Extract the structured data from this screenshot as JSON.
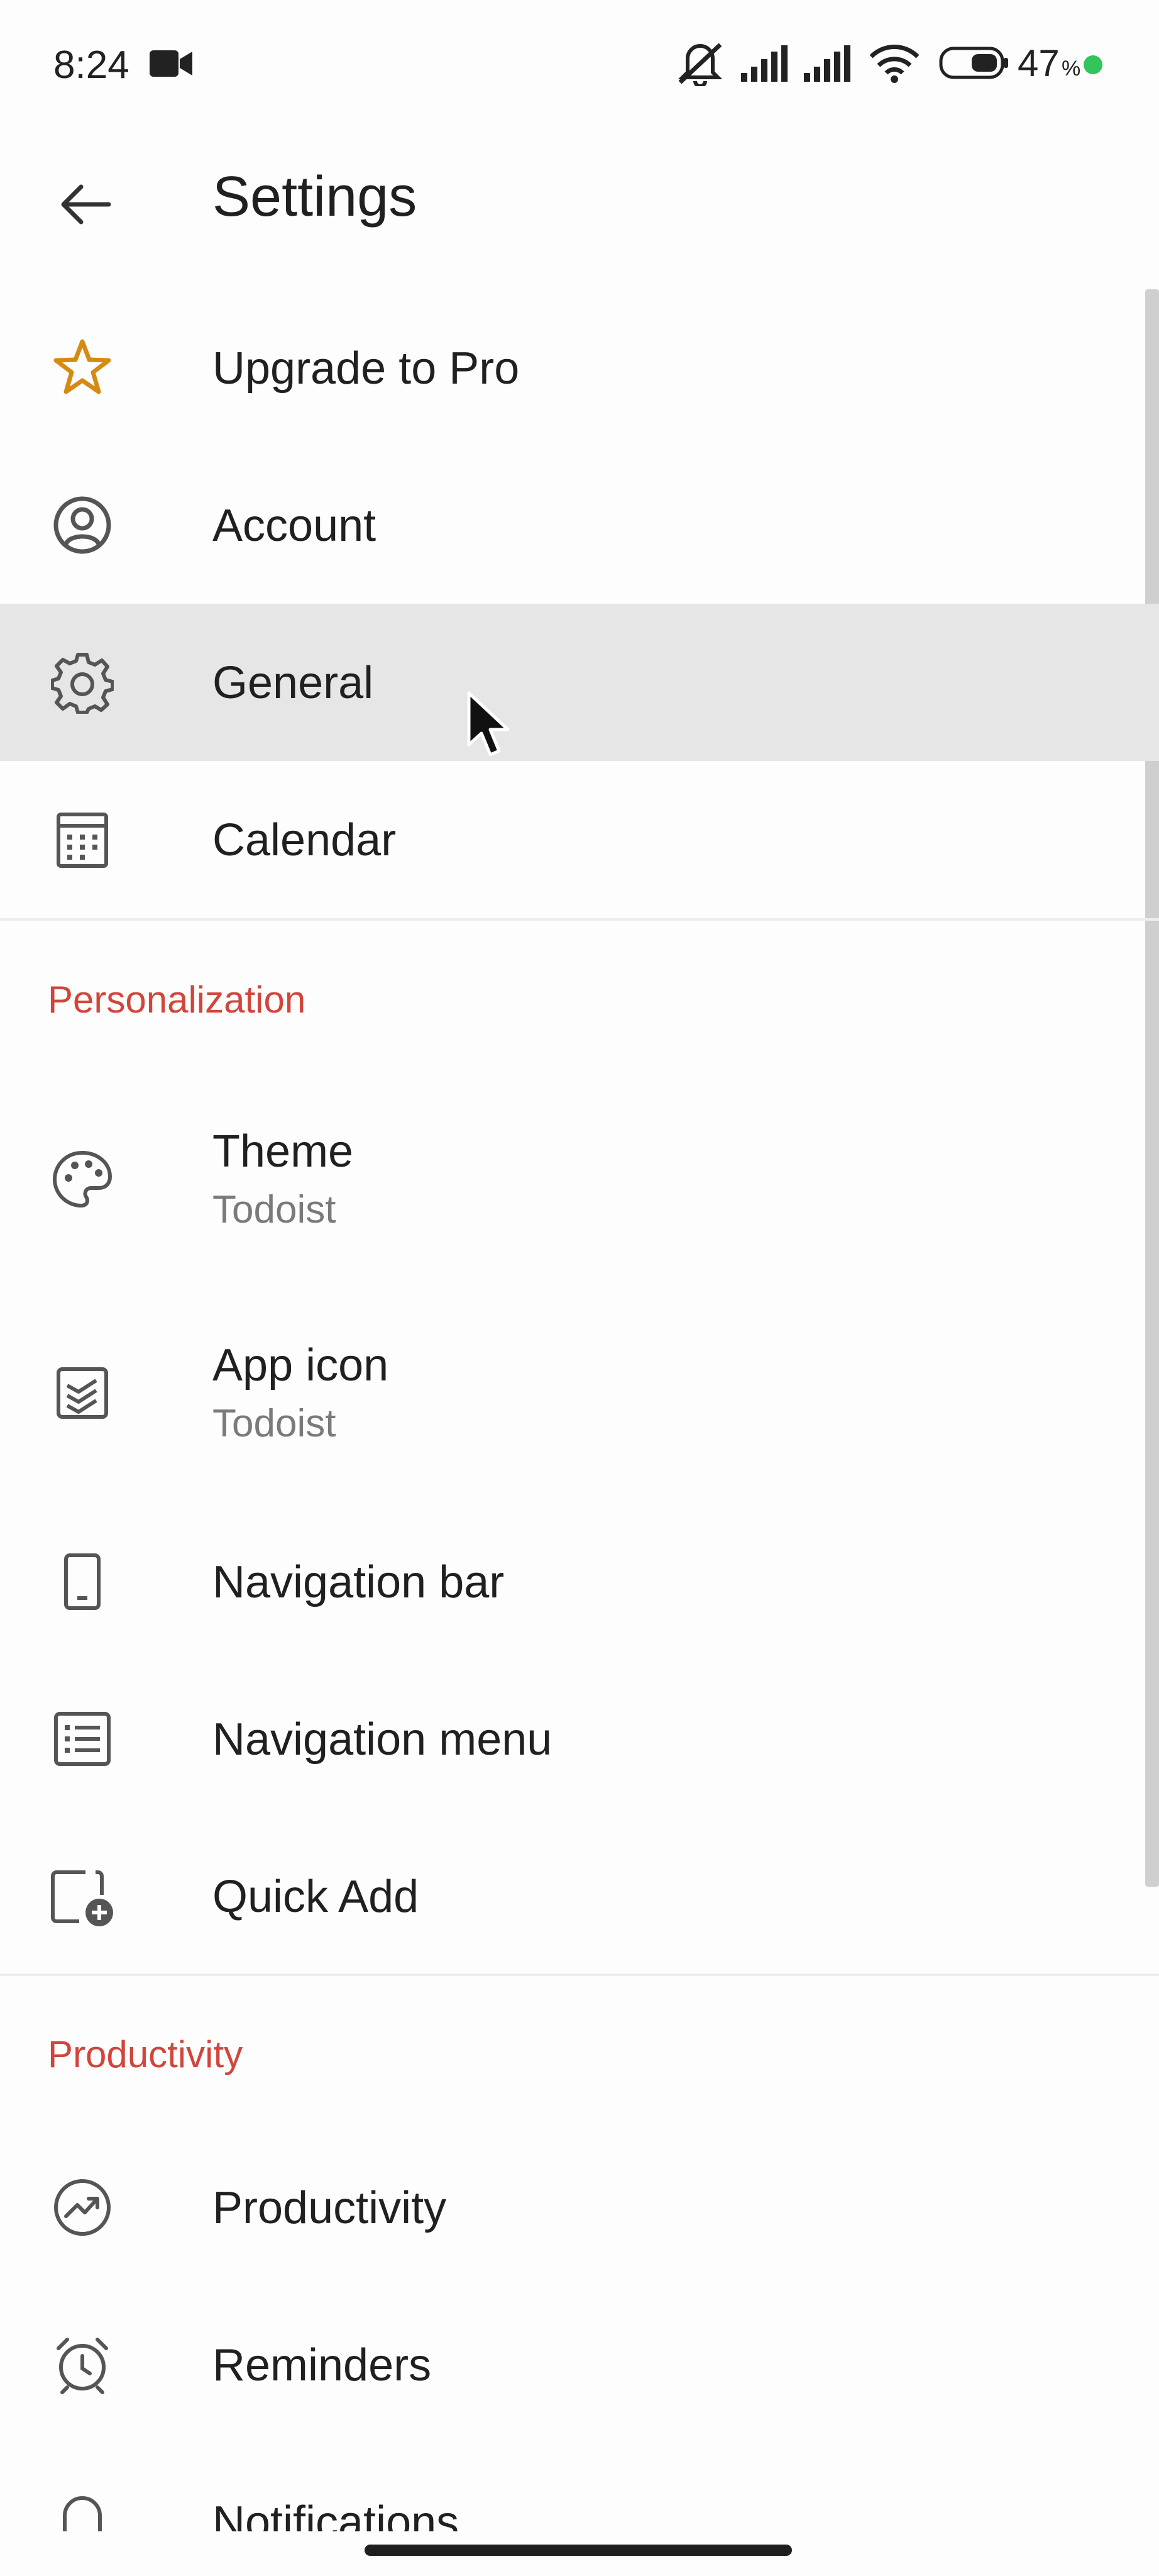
{
  "status_bar": {
    "time": "8:24",
    "battery_percent": "47",
    "percent_sign": "%",
    "icons": [
      "video-camera-icon",
      "mute-icon",
      "signal-icon",
      "signal-icon",
      "wifi-icon",
      "battery-icon",
      "privacy-dot-icon"
    ]
  },
  "toolbar": {
    "title": "Settings",
    "back_icon": "arrow-left-icon"
  },
  "items_main": [
    {
      "label": "Upgrade to Pro",
      "icon": "star-icon"
    },
    {
      "label": "Account",
      "icon": "account-icon"
    },
    {
      "label": "General",
      "icon": "gear-icon",
      "selected": true
    },
    {
      "label": "Calendar",
      "icon": "calendar-icon"
    }
  ],
  "sections": [
    {
      "title": "Personalization",
      "items": [
        {
          "label": "Theme",
          "subtitle": "Todoist",
          "icon": "palette-icon"
        },
        {
          "label": "App icon",
          "subtitle": "Todoist",
          "icon": "app-icon-icon"
        },
        {
          "label": "Navigation bar",
          "icon": "phone-icon"
        },
        {
          "label": "Navigation menu",
          "icon": "list-icon"
        },
        {
          "label": "Quick Add",
          "icon": "quick-add-icon"
        }
      ]
    },
    {
      "title": "Productivity",
      "items": [
        {
          "label": "Productivity",
          "icon": "trend-icon"
        },
        {
          "label": "Reminders",
          "icon": "alarm-icon"
        },
        {
          "label": "Notifications",
          "icon": "bell-icon"
        }
      ]
    }
  ],
  "colors": {
    "accent": "#d1453b",
    "star": "#d58a12",
    "selected_bg": "#e6e6e6"
  }
}
